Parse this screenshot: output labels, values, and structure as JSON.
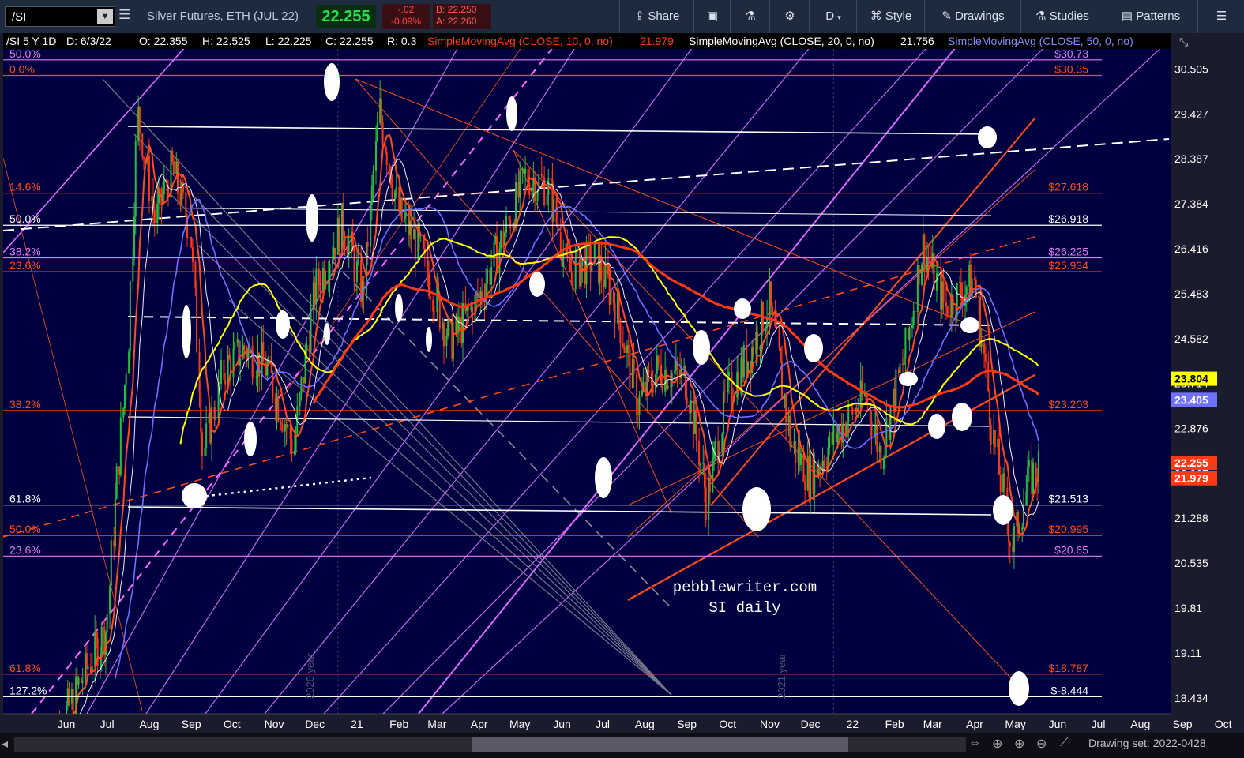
{
  "toolbar": {
    "symbol": "/SI",
    "description": "Silver Futures, ETH (JUL 22)",
    "last": "22.255",
    "change": "-.02",
    "change_pct": "-0.09%",
    "bid": "B: 22.250",
    "ask": "A: 22.260",
    "share_label": "Share",
    "period_label": "D",
    "style_label": "Style",
    "drawings_label": "Drawings",
    "studies_label": "Studies",
    "patterns_label": "Patterns"
  },
  "header": {
    "symbol": "/SI 5 Y 1D",
    "date": "D: 6/3/22",
    "open": "O: 22.355",
    "high": "H: 22.525",
    "low": "L: 22.225",
    "close": "C: 22.255",
    "range": "R: 0.3",
    "sma10": "SimpleMovingAvg (CLOSE, 10, 0, no)",
    "sma10_value": "21.979",
    "sma20": "SimpleMovingAvg (CLOSE, 20, 0, no)",
    "sma20_value": "21.756",
    "sma50": "SimpleMovingAvg (CLOSE, 50, 0, no)"
  },
  "watermark": {
    "line1": "pebblewriter.com",
    "line2": "SI daily"
  },
  "year_markers": [
    "2020 year",
    "2021 year"
  ],
  "bottom": {
    "drawing_set": "Drawing set: 2022-0428"
  },
  "colors": {
    "background": "#000040",
    "fib_orange": "#ff4a1a",
    "fib_magenta": "#e07cf0",
    "sma10": "#ff4a1a",
    "sma20": "#f0f0f0",
    "sma50": "#7070ff",
    "sma100": "#ffff00",
    "sma200": "#ff3a10",
    "up_candle": "#26c040",
    "down_candle": "#ff3a10"
  },
  "chart_data": {
    "type": "line",
    "instrument": "/SI",
    "timeframe": "5 Y 1D",
    "x_ticks": [
      "Jun",
      "Jul",
      "Aug",
      "Sep",
      "Oct",
      "Nov",
      "Dec",
      "21",
      "Feb",
      "Mar",
      "Apr",
      "May",
      "Jun",
      "Jul",
      "Aug",
      "Sep",
      "Oct",
      "Nov",
      "Dec",
      "22",
      "Feb",
      "Mar",
      "Apr",
      "May",
      "Jun",
      "Jul",
      "Aug",
      "Sep",
      "Oct"
    ],
    "y_scale": "log",
    "ylim": [
      18.2,
      31.0
    ],
    "y_ticks": [
      "30.505",
      "29.427",
      "28.387",
      "27.384",
      "26.416",
      "25.483",
      "24.582",
      "23.714",
      "22.876",
      "22.067",
      "21.288",
      "20.535",
      "19.81",
      "19.11",
      "18.434"
    ],
    "price_labels": [
      {
        "value": "22.255",
        "color": "#ff3a10"
      },
      {
        "value": "21.979",
        "color": "#ff3a10"
      },
      {
        "value": "23.804",
        "color": "#ffff00"
      },
      {
        "value": "23.405",
        "color": "#7070ff"
      }
    ],
    "fib_levels": [
      {
        "left": "50.0%",
        "right": "$30.73",
        "price": 30.73,
        "color": "#e07cf0"
      },
      {
        "left": "0.0%",
        "right": "$30.35",
        "price": 30.35,
        "color": "#ff4a1a"
      },
      {
        "left": "14.6%",
        "right": "$27.618",
        "price": 27.618,
        "color": "#ff4a1a"
      },
      {
        "left": "50.0%",
        "right": "$26.918",
        "price": 26.918,
        "color": "#ffffff"
      },
      {
        "left": "38.2%",
        "right": "$26.225",
        "price": 26.225,
        "color": "#e07cf0"
      },
      {
        "left": "23.6%",
        "right": "$25.934",
        "price": 25.934,
        "color": "#ff4a1a"
      },
      {
        "left": "38.2%",
        "right": "$23.203",
        "price": 23.203,
        "color": "#ff4a1a"
      },
      {
        "left": "61.8%",
        "right": "$21.513",
        "price": 21.513,
        "color": "#ffffff"
      },
      {
        "left": "50.0%",
        "right": "$20.995",
        "price": 20.995,
        "color": "#ff4a1a"
      },
      {
        "left": "23.6%",
        "right": "$20.65",
        "price": 20.65,
        "color": "#e07cf0"
      },
      {
        "left": "61.8%",
        "right": "$18.787",
        "price": 18.787,
        "color": "#ff4a1a"
      },
      {
        "left": "127.2%",
        "right": "$-8.444",
        "price": 18.45,
        "color": "#ffffff"
      }
    ],
    "price_series": [
      {
        "date": "2020-06",
        "price": 17.6
      },
      {
        "date": "2020-07-15",
        "price": 19.5
      },
      {
        "date": "2020-07-31",
        "price": 24.5
      },
      {
        "date": "2020-08-07",
        "price": 29.4
      },
      {
        "date": "2020-08-20",
        "price": 27.0
      },
      {
        "date": "2020-09-01",
        "price": 28.2
      },
      {
        "date": "2020-09-15",
        "price": 26.8
      },
      {
        "date": "2020-09-24",
        "price": 22.4
      },
      {
        "date": "2020-10-10",
        "price": 24.0
      },
      {
        "date": "2020-10-25",
        "price": 24.4
      },
      {
        "date": "2020-11-10",
        "price": 24.0
      },
      {
        "date": "2020-11-30",
        "price": 22.5
      },
      {
        "date": "2020-12-15",
        "price": 25.5
      },
      {
        "date": "2021-01-05",
        "price": 27.0
      },
      {
        "date": "2021-01-20",
        "price": 25.4
      },
      {
        "date": "2021-02-01",
        "price": 29.5
      },
      {
        "date": "2021-02-15",
        "price": 27.2
      },
      {
        "date": "2021-03-01",
        "price": 26.5
      },
      {
        "date": "2021-03-25",
        "price": 24.5
      },
      {
        "date": "2021-04-15",
        "price": 25.4
      },
      {
        "date": "2021-05-01",
        "price": 26.5
      },
      {
        "date": "2021-05-20",
        "price": 28.0
      },
      {
        "date": "2021-06-05",
        "price": 27.8
      },
      {
        "date": "2021-06-20",
        "price": 25.9
      },
      {
        "date": "2021-07-10",
        "price": 26.2
      },
      {
        "date": "2021-07-25",
        "price": 25.3
      },
      {
        "date": "2021-08-10",
        "price": 23.3
      },
      {
        "date": "2021-08-25",
        "price": 24.0
      },
      {
        "date": "2021-09-15",
        "price": 23.8
      },
      {
        "date": "2021-09-30",
        "price": 21.6
      },
      {
        "date": "2021-10-15",
        "price": 23.5
      },
      {
        "date": "2021-11-01",
        "price": 24.3
      },
      {
        "date": "2021-11-15",
        "price": 25.3
      },
      {
        "date": "2021-12-01",
        "price": 22.6
      },
      {
        "date": "2021-12-15",
        "price": 22.0
      },
      {
        "date": "2022-01-10",
        "price": 23.0
      },
      {
        "date": "2022-01-25",
        "price": 23.5
      },
      {
        "date": "2022-02-05",
        "price": 22.4
      },
      {
        "date": "2022-02-25",
        "price": 24.5
      },
      {
        "date": "2022-03-08",
        "price": 26.5
      },
      {
        "date": "2022-03-25",
        "price": 25.2
      },
      {
        "date": "2022-04-15",
        "price": 25.8
      },
      {
        "date": "2022-04-29",
        "price": 22.7
      },
      {
        "date": "2022-05-13",
        "price": 20.8
      },
      {
        "date": "2022-05-25",
        "price": 21.9
      },
      {
        "date": "2022-06-03",
        "price": 22.255
      }
    ],
    "moving_averages": [
      {
        "name": "SMA 10",
        "color": "#ff4a1a",
        "value": 21.979
      },
      {
        "name": "SMA 20",
        "color": "#f0f0f0",
        "value": 21.756
      },
      {
        "name": "SMA 50",
        "color": "#7070ff",
        "value": 23.405
      },
      {
        "name": "SMA 100",
        "color": "#ffff00",
        "value": 23.804
      }
    ]
  }
}
